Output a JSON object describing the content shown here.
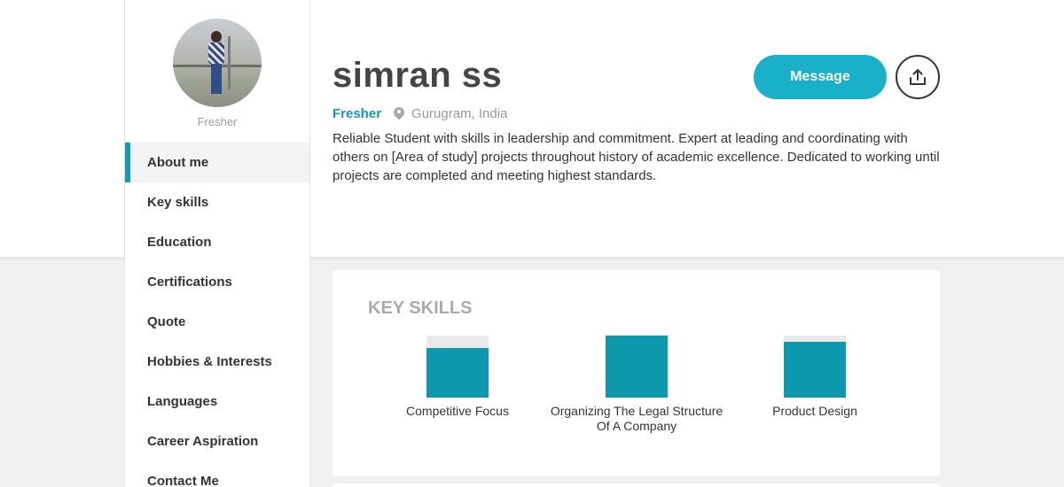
{
  "profile": {
    "name": "simran ss",
    "status": "Fresher",
    "location": "Gurugram, India",
    "bio": "Reliable Student with skills in leadership and commitment. Expert at leading and coordinating with others on [Area of study] projects throughout history of academic excellence. Dedicated to working until projects are completed and meeting highest standards.",
    "avatar_caption": "Fresher"
  },
  "actions": {
    "message_label": "Message",
    "share_icon": "share-icon"
  },
  "sidebar": {
    "items": [
      {
        "label": "About me",
        "active": true
      },
      {
        "label": "Key skills"
      },
      {
        "label": "Education"
      },
      {
        "label": "Certifications"
      },
      {
        "label": "Quote"
      },
      {
        "label": "Hobbies & Interests"
      },
      {
        "label": "Languages"
      },
      {
        "label": "Career Aspiration"
      },
      {
        "label": "Contact Me"
      }
    ]
  },
  "skills": {
    "title": "KEY SKILLS",
    "items": [
      {
        "label": "Competitive Focus",
        "level": 0.8
      },
      {
        "label": "Organizing The Legal Structure Of A Company",
        "level": 1.0
      },
      {
        "label": "Product Design",
        "level": 0.9
      }
    ]
  },
  "colors": {
    "accent": "#1ab0c9",
    "skill_fill": "#0e98ae",
    "skill_track": "#e9e9ec"
  }
}
